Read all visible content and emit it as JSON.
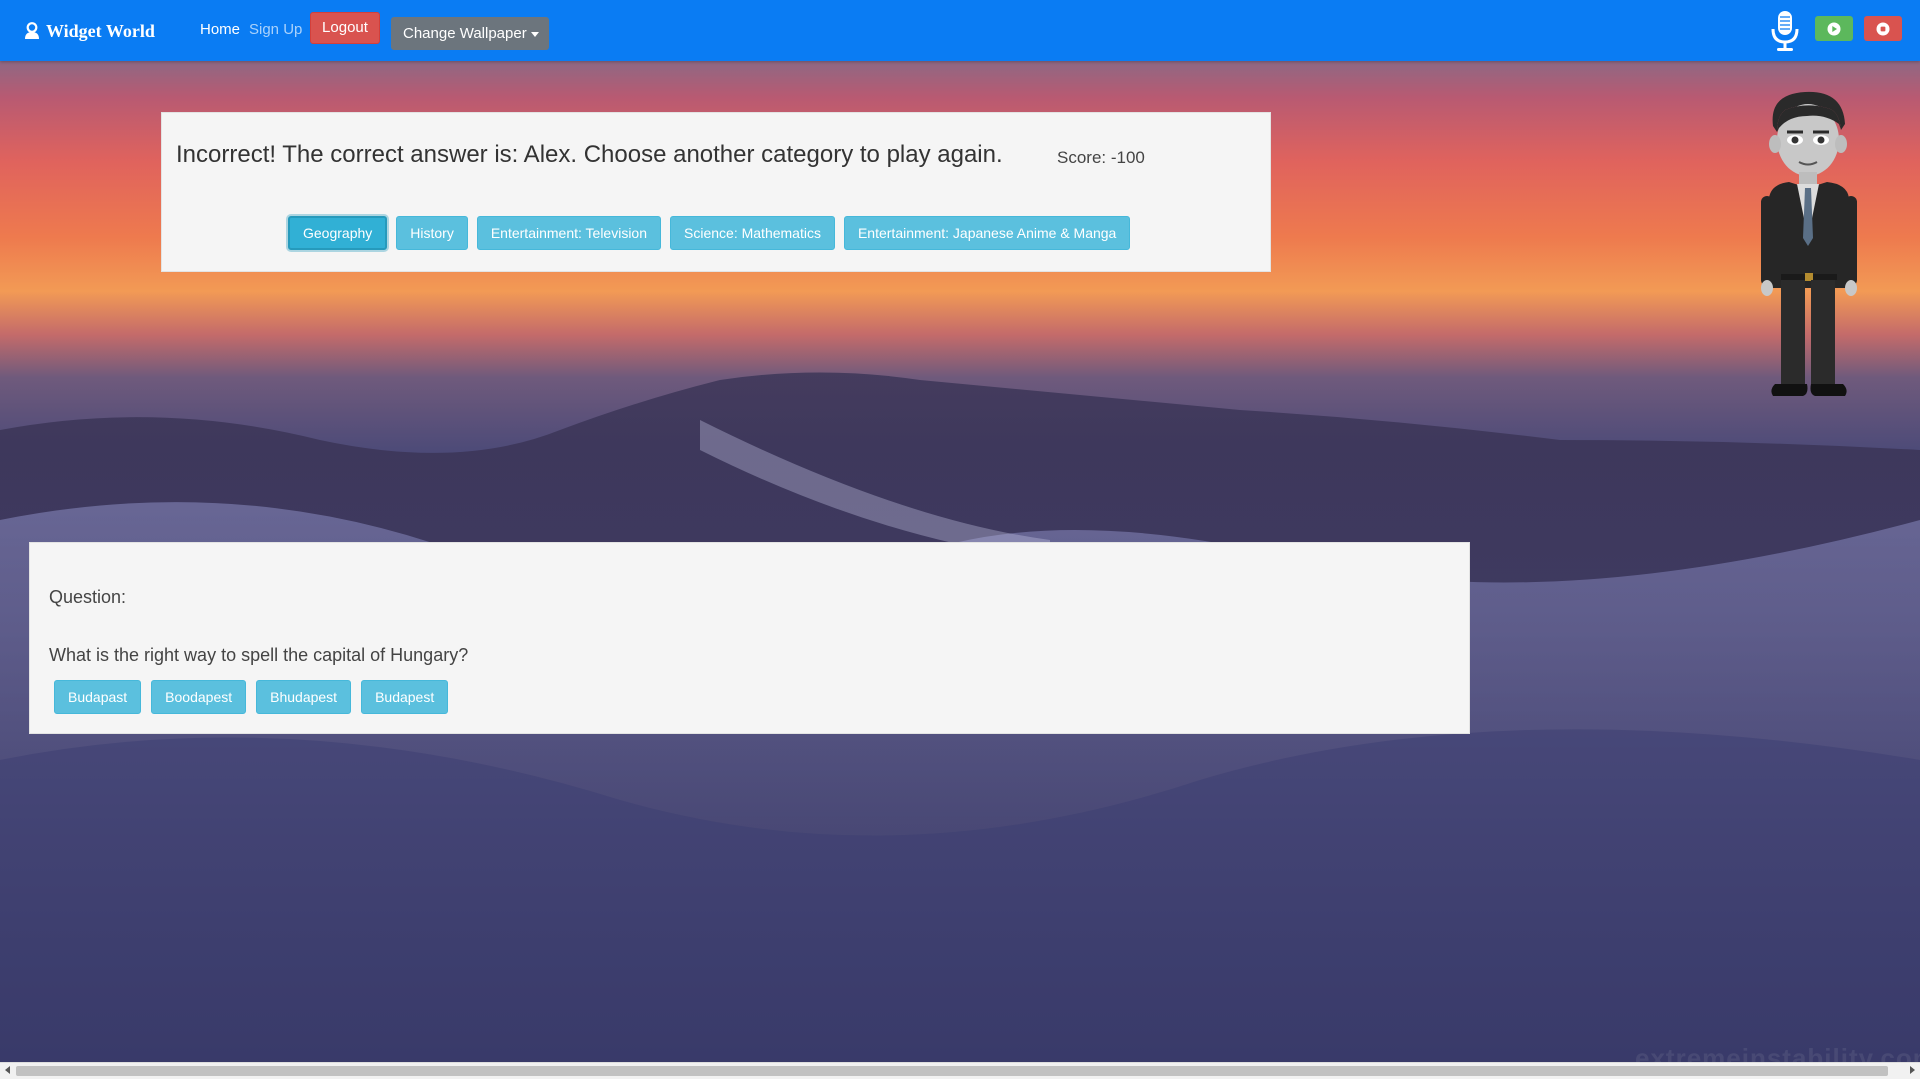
{
  "navbar": {
    "brand": "Widget World",
    "links": {
      "home": "Home",
      "signup": "Sign Up"
    },
    "logout_label": "Logout",
    "wallpaper_label": "Change Wallpaper",
    "colors": {
      "bar": "#0a7cf3",
      "logout": "#d9534f",
      "play": "#5cb85c",
      "stop": "#d9534f"
    },
    "icons": [
      "user-icon",
      "microphone-icon",
      "play-icon",
      "stop-icon"
    ]
  },
  "result": {
    "message": "Incorrect! The correct answer is: Alex. Choose another category to play again.",
    "score": "Score: -100",
    "categories": [
      "Geography",
      "History",
      "Entertainment: Television",
      "Science: Mathematics",
      "Entertainment: Japanese Anime & Manga"
    ],
    "active_category": "Geography"
  },
  "question": {
    "label": "Question:",
    "text": "What is the right way to spell the capital of Hungary?",
    "answers": [
      "Budapast",
      "Boodapest",
      "Bhudapest",
      "Budapest"
    ]
  },
  "watermark": "extremeinstability.com"
}
